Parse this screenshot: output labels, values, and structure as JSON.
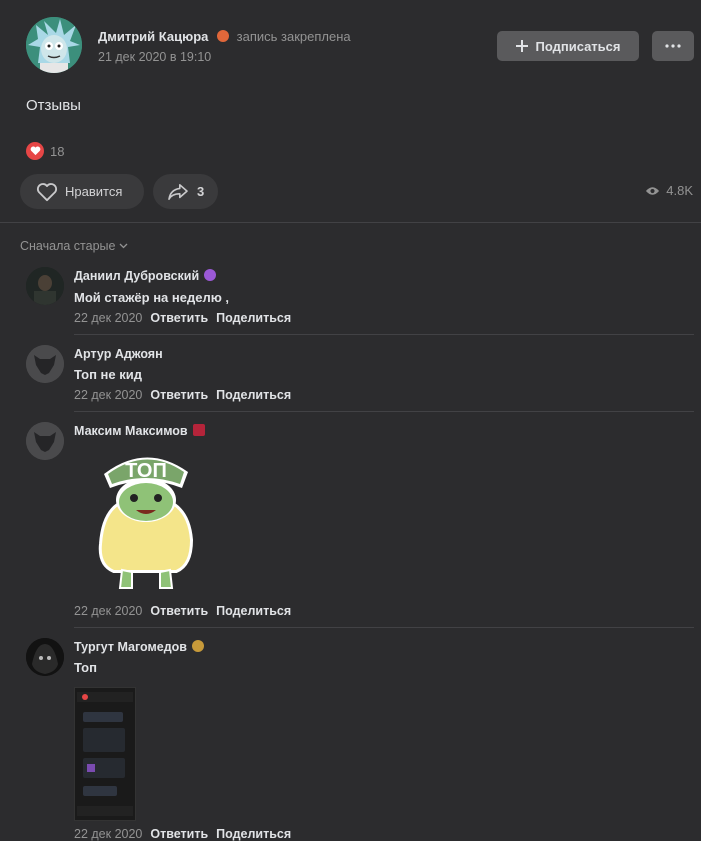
{
  "post": {
    "author": "Дмитрий Кацюра",
    "pinned_label": "запись закреплена",
    "date": "21 дек 2020 в 19:10",
    "subscribe_label": "Подписаться",
    "text": "Отзывы",
    "reactions_count": "18",
    "like_label": "Нравится",
    "share_count": "3",
    "views": "4.8K"
  },
  "comments_section": {
    "sort_label": "Сначала старые"
  },
  "comments": [
    {
      "author": "Даниил Дубровский",
      "text": "Мой стажёр на неделю ,",
      "date": "22 дек 2020",
      "reply": "Ответить",
      "share": "Поделиться"
    },
    {
      "author": "Артур Аджоян",
      "text": "Топ не кид",
      "date": "22 дек 2020",
      "reply": "Ответить",
      "share": "Поделиться"
    },
    {
      "author": "Максим Максимов",
      "sticker_text": "ТОП",
      "date": "22 дек 2020",
      "reply": "Ответить",
      "share": "Поделиться"
    },
    {
      "author": "Тургут Магомедов",
      "text": "Топ",
      "date": "22 дек 2020",
      "reply": "Ответить",
      "share": "Поделиться"
    }
  ],
  "colors": {
    "background": "#2c2c2e",
    "button": "#5a5a5c",
    "heart": "#e64646",
    "text": "#e1e3e6",
    "muted": "#939393"
  }
}
